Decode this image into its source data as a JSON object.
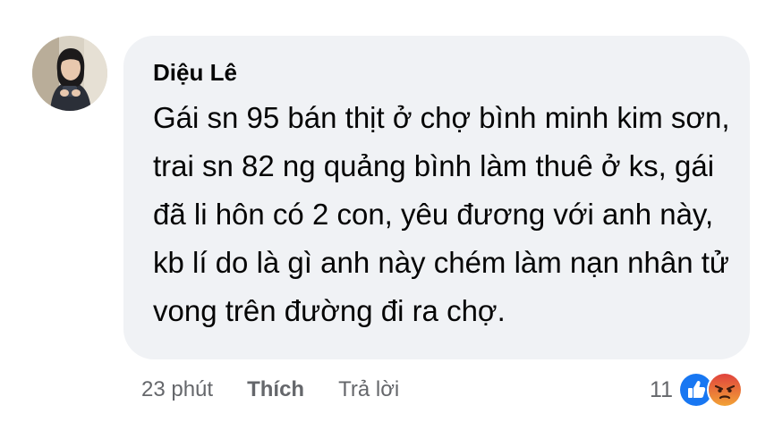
{
  "comment": {
    "author": "Diệu Lê",
    "lines": [
      "Gái sn 95 bán thịt ở chợ bình minh kim sơn,",
      "trai sn 82 ng quảng bình làm thuê ở ks, gái",
      "đã li hôn có 2 con, yêu đương với anh này,",
      "kb lí do là gì anh này chém làm nạn nhân tử",
      "vong trên đường đi ra chợ."
    ]
  },
  "actions": {
    "time": "23 phút",
    "like_label": "Thích",
    "reply_label": "Trả lời"
  },
  "reactions": {
    "count": "11",
    "icons": [
      "like-reaction-icon",
      "angry-reaction-icon"
    ],
    "like_color": "#1877f2",
    "angry_color": "#e9710f"
  },
  "colors": {
    "bubble": "#f0f2f5",
    "text": "#050505",
    "meta": "#65676b"
  }
}
